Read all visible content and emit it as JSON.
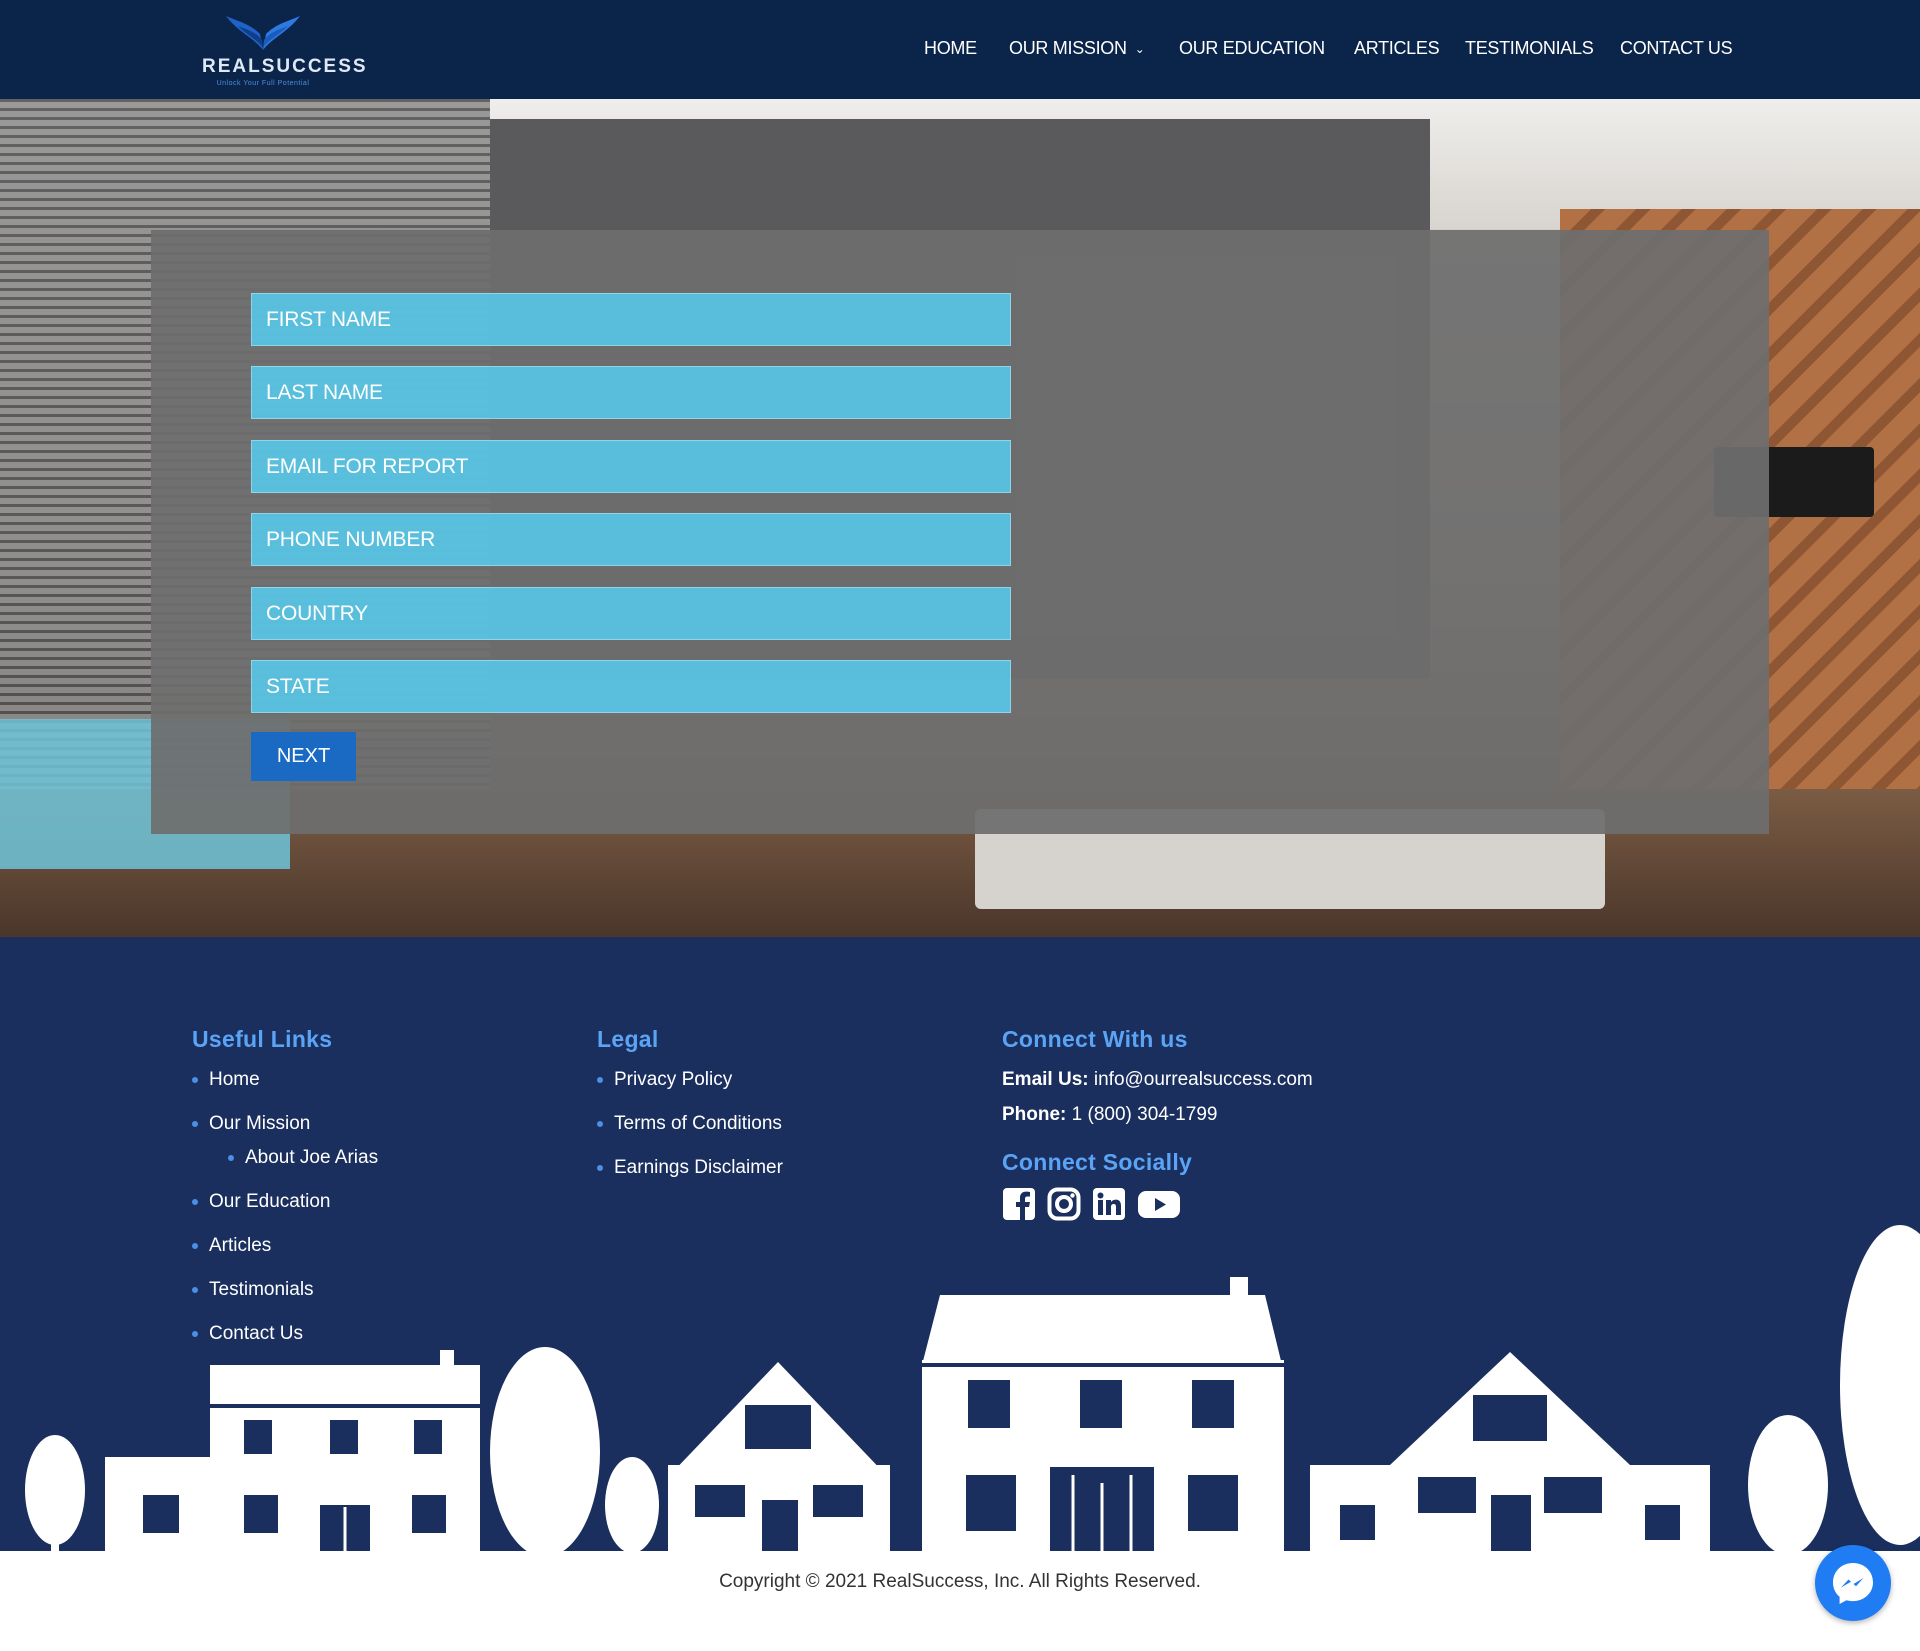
{
  "header": {
    "logo_name": "REALSUCCESS",
    "logo_tagline": "Unlock Your Full Potential",
    "nav": [
      "HOME",
      "OUR MISSION",
      "OUR EDUCATION",
      "ARTICLES",
      "TESTIMONIALS",
      "CONTACT US"
    ]
  },
  "form": {
    "fields": [
      "FIRST NAME",
      "LAST NAME",
      "EMAIL FOR REPORT",
      "PHONE NUMBER",
      "COUNTRY",
      "STATE"
    ],
    "next_label": "NEXT"
  },
  "footer": {
    "useful_links_title": "Useful Links",
    "useful_links": [
      "Home",
      "Our Mission",
      "About Joe Arias",
      "Our Education",
      "Articles",
      "Testimonials",
      "Contact Us"
    ],
    "legal_title": "Legal",
    "legal_links": [
      "Privacy Policy",
      "Terms of Conditions",
      "Earnings Disclaimer"
    ],
    "connect_title": "Connect With us",
    "email_label": "Email Us:",
    "email_value": "info@ourrealsuccess.com",
    "phone_label": "Phone:",
    "phone_value": "1 (800) 304-1799",
    "social_title": "Connect Socially",
    "social_icons": [
      "facebook-icon",
      "instagram-icon",
      "linkedin-icon",
      "youtube-icon"
    ],
    "copyright": "Copyright © 2021 RealSuccess, Inc. All Rights Reserved."
  },
  "colors": {
    "header_bg": "#0b2449",
    "footer_bg": "#1a2f5e",
    "field_bg": "#56c8e8",
    "button_bg": "#1a6ac4",
    "footer_heading": "#5ba4f5"
  }
}
